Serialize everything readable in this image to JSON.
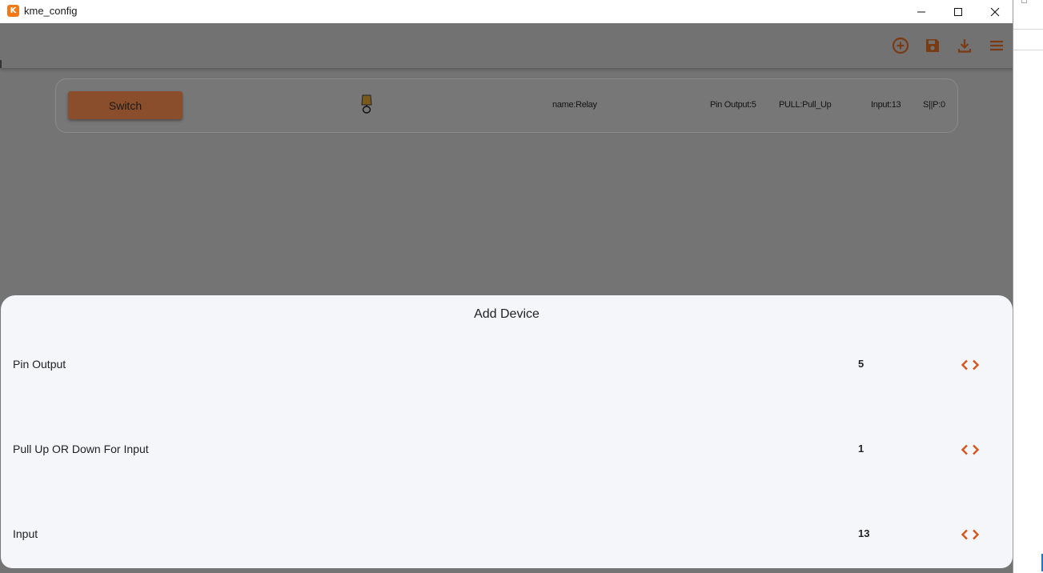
{
  "window": {
    "title": "kme_config",
    "app_icon_letter": "K",
    "accent_color": "#d9541a"
  },
  "appbar": {
    "icons": [
      "add-circle-icon",
      "save-icon",
      "download-icon",
      "menu-icon"
    ]
  },
  "device": {
    "switch_label": "Switch",
    "icon": "lamp-icon",
    "name": "name:Relay",
    "pin_output": "Pin Output:5",
    "pull": "PULL:Pull_Up",
    "input": "Input:13",
    "sip": "S||P:0"
  },
  "sheet": {
    "title": "Add Device",
    "rows": [
      {
        "label": "Pin Output",
        "value": "5"
      },
      {
        "label": "Pull Up OR Down For Input",
        "value": "1"
      },
      {
        "label": "Input",
        "value": "13"
      }
    ]
  }
}
